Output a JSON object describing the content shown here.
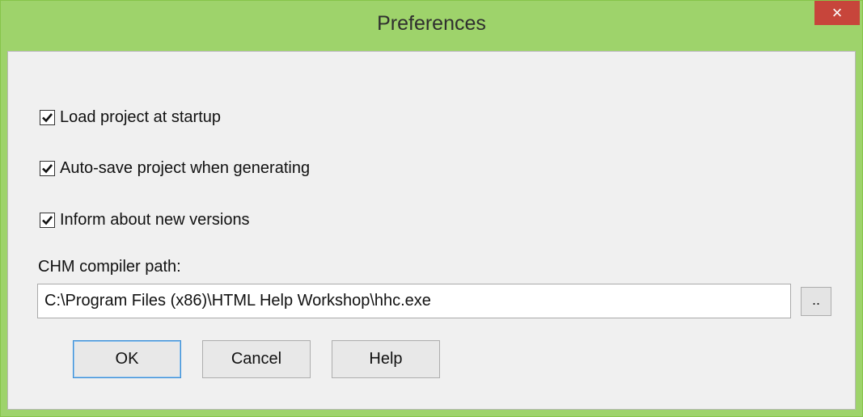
{
  "window": {
    "title": "Preferences",
    "close_label": "×"
  },
  "options": [
    {
      "label": "Load project at startup",
      "checked": true
    },
    {
      "label": "Auto-save project when generating",
      "checked": true
    },
    {
      "label": "Inform about new versions",
      "checked": true
    }
  ],
  "compiler": {
    "label": "CHM compiler path:",
    "value": "C:\\Program Files (x86)\\HTML Help Workshop\\hhc.exe",
    "browse_label": ".."
  },
  "buttons": {
    "ok": "OK",
    "cancel": "Cancel",
    "help": "Help"
  },
  "colors": {
    "titlebar": "#9ed36b",
    "close": "#c7453b",
    "client": "#f0f0f0"
  }
}
